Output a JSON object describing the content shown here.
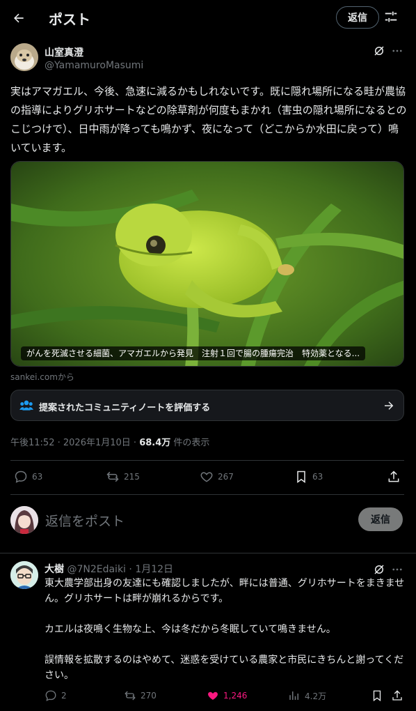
{
  "header": {
    "title": "ポスト",
    "reply_label": "返信"
  },
  "post": {
    "author_name": "山室真澄",
    "author_handle": "@YamamuroMasumi",
    "text": "実はアマガエル、今後、急速に減るかもしれないです。既に隠れ場所になる畦が農協の指導によりグリホサートなどの除草剤が何度もまかれ（害虫の隠れ場所になるとのこじつけで）、日中雨が降っても鳴かず、夜になって（どこからか水田に戻って）鳴いています。",
    "card_title": "がんを死滅させる細菌、アマガエルから発見　注射１回で腸の腫瘍完治　特効薬となる...",
    "card_source": "sankei.comから",
    "community_note_prompt": "提案されたコミュニティノートを評価する",
    "time": "午後11:52",
    "date": "2026年1月10日",
    "views_count": "68.4万",
    "views_label": "件の表示",
    "replies": "63",
    "reposts": "215",
    "likes": "267",
    "bookmarks": "63"
  },
  "composer": {
    "placeholder": "返信をポスト",
    "button_label": "返信"
  },
  "reply": {
    "author_name": "大樹",
    "author_handle": "@7N2Edaiki",
    "date": "1月12日",
    "paragraph1": "東大農学部出身の友達にも確認しましたが、畔には普通、グリホサートをまきません。グリホサートは畔が崩れるからです。",
    "paragraph2": "カエルは夜鳴く生物な上、今は冬だから冬眠していて鳴きません。",
    "paragraph3": "誤情報を拡散するのはやめて、迷惑を受けている農家と市民にきちんと謝ってください。",
    "replies": "2",
    "reposts": "270",
    "likes": "1,246",
    "views": "4.2万"
  },
  "colors": {
    "background": "#000000",
    "text": "#e7e9ea",
    "muted": "#71767b",
    "border": "#2f3336",
    "like_active": "#f91880",
    "community": "#1d9bf0"
  },
  "icons": [
    "back-arrow-icon",
    "sliders-icon",
    "grok-icon",
    "more-icon",
    "community-people-icon",
    "arrow-right-icon",
    "reply-icon",
    "repost-icon",
    "like-icon",
    "bookmark-icon",
    "share-icon",
    "views-icon"
  ]
}
